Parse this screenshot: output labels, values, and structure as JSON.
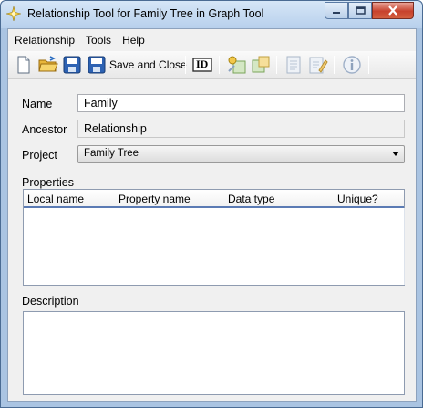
{
  "window": {
    "title": "Relationship Tool for Family Tree in Graph Tool"
  },
  "menu": {
    "items": [
      {
        "label": "Relationship"
      },
      {
        "label": "Tools"
      },
      {
        "label": "Help"
      }
    ]
  },
  "toolbar": {
    "save_and_close_label": "Save and Close",
    "id_label": "ID"
  },
  "form": {
    "name_label": "Name",
    "name_value": "Family",
    "ancestor_label": "Ancestor",
    "ancestor_value": "Relationship",
    "project_label": "Project",
    "project_value": "Family Tree",
    "properties_label": "Properties",
    "description_label": "Description"
  },
  "properties_table": {
    "columns": [
      "Local name",
      "Property name",
      "Data type",
      "Unique?"
    ]
  }
}
